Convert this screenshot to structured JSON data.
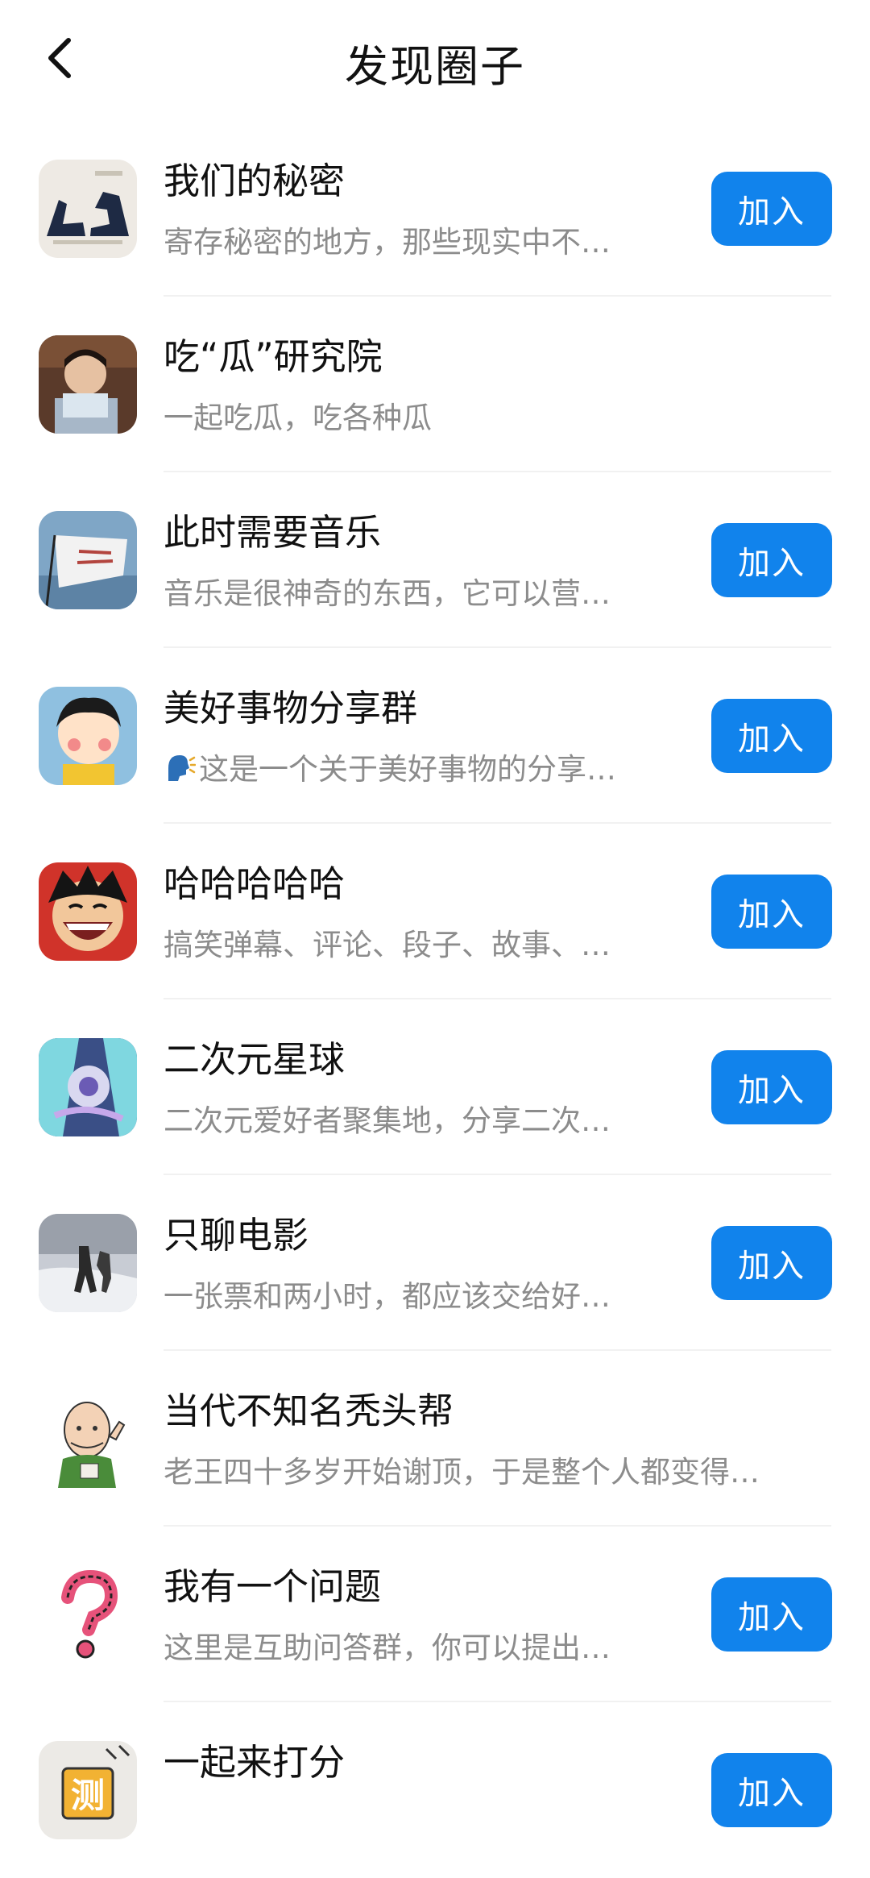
{
  "header": {
    "title": "发现圈子",
    "back_icon": "chevron-left-icon"
  },
  "join_label": "加入",
  "circles": [
    {
      "name": "我们的秘密",
      "desc": "寄存秘密的地方，那些现实中不…",
      "joinable": true
    },
    {
      "name": "吃“瓜”研究院",
      "desc": "一起吃瓜，吃各种瓜",
      "joinable": false
    },
    {
      "name": "此时需要音乐",
      "desc": "音乐是很神奇的东西，它可以营…",
      "joinable": true
    },
    {
      "name": "美好事物分享群",
      "desc": "这是一个关于美好事物的分享…",
      "joinable": true,
      "desc_icon": "speaking-head-icon"
    },
    {
      "name": "哈哈哈哈哈",
      "desc": "搞笑弹幕、评论、段子、故事、…",
      "joinable": true
    },
    {
      "name": "二次元星球",
      "desc": "二次元爱好者聚集地，分享二次…",
      "joinable": true
    },
    {
      "name": "只聊电影",
      "desc": "一张票和两小时，都应该交给好…",
      "joinable": true
    },
    {
      "name": "当代不知名秃头帮",
      "desc": "老王四十多岁开始谢顶，于是整个人都变得…",
      "joinable": false
    },
    {
      "name": "我有一个问题",
      "desc": "这里是互助问答群，你可以提出…",
      "joinable": true
    },
    {
      "name": "一起来打分",
      "desc": "",
      "joinable": true,
      "avatar_text": "测"
    }
  ],
  "colors": {
    "accent": "#1183ec",
    "desc_text": "#8c8c8c",
    "divider": "#f1f1f1"
  }
}
